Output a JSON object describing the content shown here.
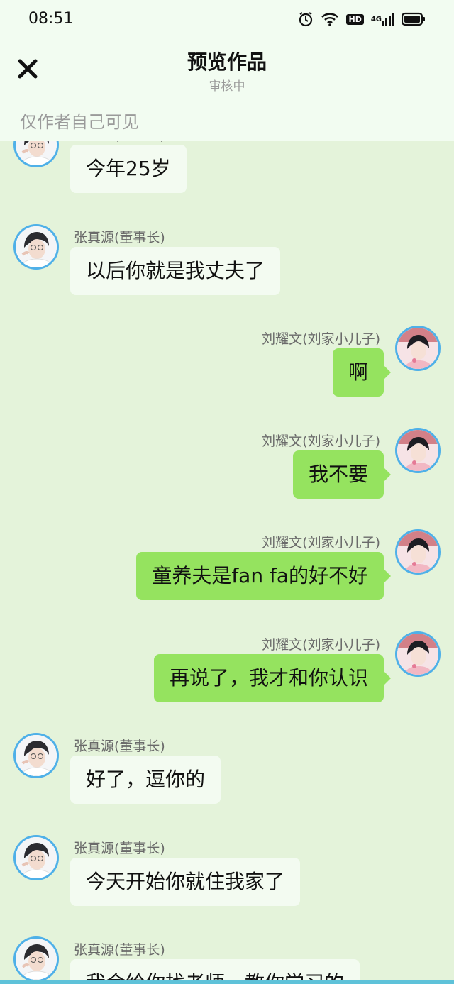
{
  "status_bar": {
    "time": "08:51",
    "hd_label": "HD",
    "network_label": "4G"
  },
  "header": {
    "title": "预览作品",
    "subtitle": "审核中",
    "visibility_note": "仅作者自己可见"
  },
  "icons": {
    "close": "close-icon",
    "alarm": "alarm-icon",
    "wifi": "wifi-icon",
    "signal": "signal-icon",
    "battery": "battery-icon"
  },
  "colors": {
    "header_bg": "#f2fcf1",
    "chat_bg": "#e4f3da",
    "left_bubble": "#f3fbf1",
    "right_bubble": "#95e35f",
    "avatar_border": "#4fb0e8"
  },
  "messages": [
    {
      "side": "left",
      "sender": "张真源(董事长)",
      "text": "今年25岁"
    },
    {
      "side": "left",
      "sender": "张真源(董事长)",
      "text": "以后你就是我丈夫了"
    },
    {
      "side": "right",
      "sender": "刘耀文(刘家小儿子)",
      "text": "啊"
    },
    {
      "side": "right",
      "sender": "刘耀文(刘家小儿子)",
      "text": "我不要"
    },
    {
      "side": "right",
      "sender": "刘耀文(刘家小儿子)",
      "text": "童养夫是fan fa的好不好"
    },
    {
      "side": "right",
      "sender": "刘耀文(刘家小儿子)",
      "text": "再说了，我才和你认识"
    },
    {
      "side": "left",
      "sender": "张真源(董事长)",
      "text": "好了，逗你的"
    },
    {
      "side": "left",
      "sender": "张真源(董事长)",
      "text": "今天开始你就住我家了"
    },
    {
      "side": "left",
      "sender": "张真源(董事长)",
      "text": "我会给你找老师，教你学习的"
    }
  ]
}
